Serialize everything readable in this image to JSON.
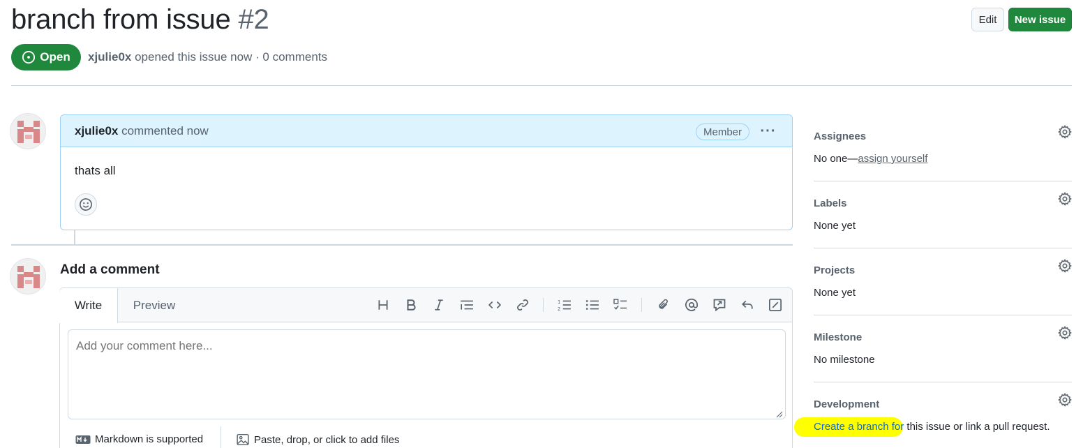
{
  "issue": {
    "title": "branch from issue",
    "number": "#2",
    "state": "Open",
    "author": "xjulie0x",
    "meta_text": " opened this issue now · 0 comments"
  },
  "header_buttons": {
    "edit": "Edit",
    "new_issue": "New issue"
  },
  "comment": {
    "author": "xjulie0x",
    "action": " commented now",
    "role_badge": "Member",
    "body": "thats all"
  },
  "add_comment": {
    "heading": "Add a comment",
    "tabs": [
      "Write",
      "Preview"
    ],
    "placeholder": "Add your comment here...",
    "markdown_note": "Markdown is supported",
    "files_note": "Paste, drop, or click to add files",
    "toolbar_icons": [
      "heading-icon",
      "bold-icon",
      "italic-icon",
      "quote-icon",
      "code-icon",
      "link-icon",
      "numbered-list-icon",
      "bulleted-list-icon",
      "task-list-icon",
      "attach-icon",
      "mention-icon",
      "reference-icon",
      "reply-icon",
      "slash-command-icon"
    ]
  },
  "sidebar": {
    "assignees": {
      "title": "Assignees",
      "prefix": "No one—",
      "link": "assign yourself"
    },
    "labels": {
      "title": "Labels",
      "value": "None yet"
    },
    "projects": {
      "title": "Projects",
      "value": "None yet"
    },
    "milestone": {
      "title": "Milestone",
      "value": "No milestone"
    },
    "development": {
      "title": "Development",
      "link": "Create a branch for",
      "rest": " this issue or link a pull request."
    }
  },
  "colors": {
    "open_green": "#1f883d",
    "comment_header_bg": "#ddf4ff",
    "highlight": "#ffff00"
  }
}
